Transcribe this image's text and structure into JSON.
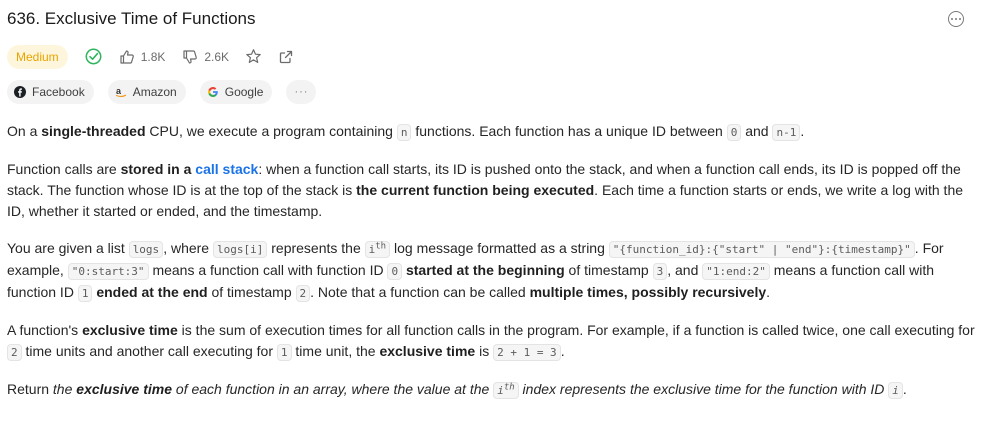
{
  "header": {
    "title": "636. Exclusive Time of Functions"
  },
  "meta": {
    "difficulty": "Medium",
    "likes": "1.8K",
    "dislikes": "2.6K"
  },
  "companies": [
    {
      "name": "Facebook",
      "icon": "facebook-icon"
    },
    {
      "name": "Amazon",
      "icon": "amazon-icon"
    },
    {
      "name": "Google",
      "icon": "google-icon"
    }
  ],
  "colors": {
    "difficulty_text": "#e7a400",
    "difficulty_bg": "#fef6dc",
    "solved_check": "#2db55d",
    "link": "#1a73e8"
  },
  "description": {
    "p1": {
      "a": "On a ",
      "b": "single-threaded",
      "c": " CPU, we execute a program containing ",
      "code_n": "n",
      "d": " functions. Each function has a unique ID between ",
      "code_0": "0",
      "e": " and ",
      "code_n1": "n-1",
      "f": "."
    },
    "p2": {
      "a": "Function calls are ",
      "b": "stored in a ",
      "link": "call stack",
      "c": ": when a function call starts, its ID is pushed onto the stack, and when a function call ends, its ID is popped off the stack. The function whose ID is at the top of the stack is ",
      "d": "the current function being executed",
      "e": ". Each time a function starts or ends, we write a log with the ID, whether it started or ended, and the timestamp."
    },
    "p3": {
      "a": "You are given a list ",
      "code_logs": "logs",
      "b": ", where ",
      "code_logsi": "logs[i]",
      "c": " represents the ",
      "code_i": "i",
      "sup_th": "th",
      "d": " log message formatted as a string ",
      "code_fmt": "\"{function_id}:{\"start\" | \"end\"}:{timestamp}\"",
      "e": ". For example, ",
      "code_ex1": "\"0:start:3\"",
      "f": " means a function call with function ID ",
      "code_0": "0",
      "g": " ",
      "h": "started at the beginning",
      "i": " of timestamp ",
      "code_3": "3",
      "j": ", and ",
      "code_ex2": "\"1:end:2\"",
      "k": " means a function call with function ID ",
      "code_1": "1",
      "l": " ",
      "m": "ended at the end",
      "n": " of timestamp ",
      "code_2": "2",
      "o": ". Note that a function can be called ",
      "p": "multiple times, possibly recursively",
      "q": "."
    },
    "p4": {
      "a": "A function's ",
      "b": "exclusive time",
      "c": " is the sum of execution times for all function calls in the program. For example, if a function is called twice, one call executing for ",
      "code_2": "2",
      "d": " time units and another call executing for ",
      "code_1": "1",
      "e": " time unit, the ",
      "f": "exclusive time",
      "g": " is ",
      "code_sum": "2 + 1 = 3",
      "h": "."
    },
    "p5": {
      "a": "Return ",
      "b": "the ",
      "c": "exclusive time",
      "d": " of each function in an array, where the value at the ",
      "code_i": "i",
      "sup_th": "th",
      "e": " index represents the exclusive time for the function with ID ",
      "code_i2": "i",
      "f": "."
    }
  }
}
